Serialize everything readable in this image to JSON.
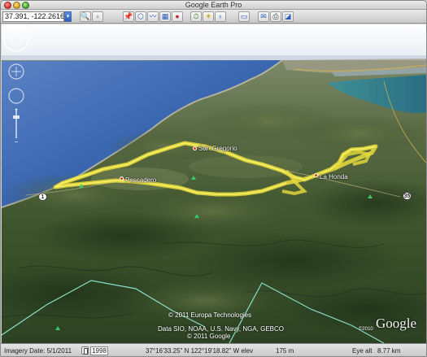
{
  "window": {
    "title": "Google Earth Pro"
  },
  "search": {
    "value": "37.391, -122.2616"
  },
  "toolbar": {
    "buttons": [
      {
        "name": "search-panel-icon",
        "glyph": "🔍"
      },
      {
        "name": "tour-icon",
        "glyph": "▫"
      },
      {
        "name": "placemark-icon",
        "glyph": "📌"
      },
      {
        "name": "polygon-icon",
        "glyph": "⬡"
      },
      {
        "name": "path-icon",
        "glyph": "〰"
      },
      {
        "name": "image-overlay-icon",
        "glyph": "▦"
      },
      {
        "name": "record-tour-icon",
        "glyph": "●"
      },
      {
        "name": "historical-imagery-icon",
        "glyph": "⏱"
      },
      {
        "name": "sunlight-icon",
        "glyph": "☀"
      },
      {
        "name": "switch-to-sky-icon",
        "glyph": "♁"
      },
      {
        "name": "ruler-icon",
        "glyph": "▭"
      },
      {
        "name": "email-icon",
        "glyph": "✉"
      },
      {
        "name": "print-icon",
        "glyph": "⎙"
      },
      {
        "name": "google-maps-icon",
        "glyph": "◪"
      }
    ]
  },
  "map": {
    "places": {
      "san_gregorio": "San Gregorio",
      "pescadero": "Pescadero",
      "la_honda": "La Honda"
    },
    "route_shields": {
      "hwy1": "1",
      "hwy35": "35"
    },
    "credits": {
      "europa": "© 2011 Europa Technologies",
      "data": "Data SIO, NOAA, U.S. Navy, NGA, GEBCO",
      "google": "© 2011 Google"
    },
    "logo_year": "©2010",
    "logo": "Google"
  },
  "status": {
    "imagery_date": "Imagery Date: 5/1/2011",
    "year": "1998",
    "coords": "37°16'33.25\" N 122°19'18.82\" W elev",
    "elev": "175 m",
    "eye_alt_label": "Eye alt",
    "eye_alt": "8.77 km"
  },
  "colors": {
    "ocean": "#3a66b0",
    "track": "#e8dc3a",
    "sky": "#f2f4f7"
  }
}
